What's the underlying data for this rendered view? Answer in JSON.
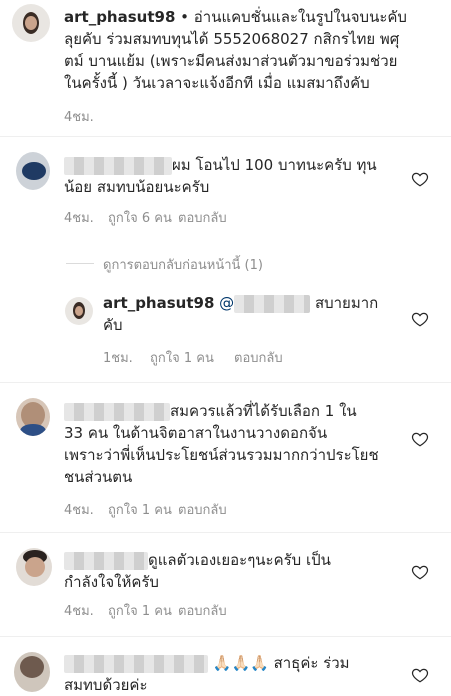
{
  "post": {
    "username": "art_phasut98",
    "caption_lines": [
      "art_phasut98 • อ่านแคบชั่นและในรูปในจบนะคับ",
      "ลุยคับ ร่วมสมทบทุนได้ 5552068027 กสิกรไทย พศุ",
      "ตม์ บานแย้ม (เพราะมีคนส่งมาส่วนตัวมาขอร่วมช่วย",
      "ในครั้งนี้ ) วันเวลาจะแจ้งอีกที เมื่อ แมสมาถึงคับ"
    ],
    "time": "4ชม."
  },
  "comments": [
    {
      "lines": [
        "ผม โอนไป 100 บาทนะครับ ทุน",
        "น้อย สมทบน้อยนะครับ"
      ],
      "time": "4ชม.",
      "likes": "ถูกใจ 6 คน",
      "reply": "ตอบกลับ"
    },
    {
      "view_replies": "ดูการตอบกลับก่อนหน้านี้ (1)"
    },
    {
      "username": "art_phasut98",
      "mention": "@",
      "lines": [
        "สบายมาก",
        "คับ"
      ],
      "time": "1ชม.",
      "likes": "ถูกใจ 1 คน",
      "reply": "ตอบกลับ"
    },
    {
      "lines": [
        "สมควรแล้วที่ได้รับเลือก 1 ใน",
        "33 คน ในด้านจิตอาสาในงานวางดอกจัน",
        "เพราะว่าพี่เห็นประโยชน์ส่วนรวมมากกว่าประโยช",
        "ชนส่วนตน"
      ],
      "time": "4ชม.",
      "likes": "ถูกใจ 1 คน",
      "reply": "ตอบกลับ"
    },
    {
      "lines": [
        "ดูแลตัวเองเยอะๆนะครับ เป็น",
        "กำลังใจให้ครับ"
      ],
      "time": "4ชม.",
      "likes": "ถูกใจ 1 คน",
      "reply": "ตอบกลับ"
    },
    {
      "emoji": "🙏🏻🙏🏻🙏🏻",
      "lines": [
        "สาธุค่ะ ร่วม",
        "สมทบด้วยค่ะ"
      ]
    }
  ],
  "icons": {
    "heart": "heart-outline-icon"
  }
}
